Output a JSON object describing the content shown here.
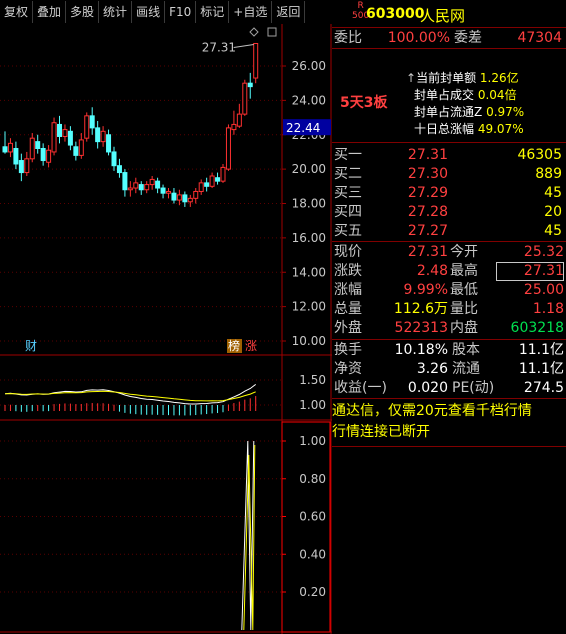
{
  "toolbar": {
    "buttons": [
      "复权",
      "叠加",
      "多股",
      "统计",
      "画线",
      "F10",
      "标记",
      "+自选",
      "返回"
    ]
  },
  "header": {
    "badge_top": "R",
    "badge_bottom": "500",
    "code": "603000",
    "name": "人民网"
  },
  "weibi": {
    "label": "委比",
    "value": "100.00%",
    "label2": "委差",
    "value2": "47304"
  },
  "board": {
    "streak": "5天3板",
    "items": [
      {
        "label": "当前封单额",
        "value": "1.26亿",
        "arrow": "↑"
      },
      {
        "label": "封单占成交",
        "value": "0.04倍"
      },
      {
        "label": "封单占流通Z",
        "value": "0.97%"
      },
      {
        "label": "十日总涨幅",
        "value": "49.07%"
      }
    ]
  },
  "order_book": [
    {
      "label": "买一",
      "price": "27.31",
      "volume": "46305"
    },
    {
      "label": "买二",
      "price": "27.30",
      "volume": "889"
    },
    {
      "label": "买三",
      "price": "27.29",
      "volume": "45"
    },
    {
      "label": "买四",
      "price": "27.28",
      "volume": "20"
    },
    {
      "label": "买五",
      "price": "27.27",
      "volume": "45"
    }
  ],
  "quote": [
    {
      "l1": "现价",
      "v1": "27.31",
      "c1": "red",
      "l2": "今开",
      "v2": "25.32",
      "c2": "red"
    },
    {
      "l1": "涨跌",
      "v1": "2.48",
      "c1": "red",
      "l2": "最高",
      "v2": "27.31",
      "c2": "red"
    },
    {
      "l1": "涨幅",
      "v1": "9.99%",
      "c1": "red",
      "l2": "最低",
      "v2": "25.00",
      "c2": "red"
    },
    {
      "l1": "总量",
      "v1": "112.6万",
      "c1": "yel",
      "l2": "量比",
      "v2": "1.18",
      "c2": "red"
    },
    {
      "l1": "外盘",
      "v1": "522313",
      "c1": "red",
      "l2": "内盘",
      "v2": "603218",
      "c2": "grn"
    }
  ],
  "fundamentals": [
    {
      "l1": "换手",
      "v1": "10.18%",
      "l2": "股本",
      "v2": "11.1亿"
    },
    {
      "l1": "净资",
      "v1": "3.26",
      "l2": "流通",
      "v2": "11.1亿"
    },
    {
      "l1": "收益(一)",
      "v1": "0.020",
      "l2": "PE(动)",
      "v2": "274.5"
    }
  ],
  "notices": [
    "通达信，仅需20元查看千档行情",
    "行情连接已断开"
  ],
  "chart": {
    "price_axis": [
      "26.00",
      "24.00",
      "22.00",
      "20.00",
      "18.00",
      "16.00",
      "14.00",
      "12.00",
      "10.00"
    ],
    "current_price_tag": "22.44",
    "high_label": "27.31",
    "tag_cai": "财",
    "tag_bang": "榜",
    "tag_zhang": "涨",
    "indicator_axis": [
      "1.50",
      "1.00"
    ],
    "osc_axis": [
      "1.00",
      "0.80",
      "0.60",
      "0.40",
      "0.20"
    ]
  },
  "chart_data": {
    "type": "candlestick",
    "ylim": [
      9.5,
      28.5
    ],
    "candles": [
      [
        21.3,
        21.0,
        22.2,
        20.9
      ],
      [
        21.0,
        21.5,
        21.8,
        20.7
      ],
      [
        21.2,
        20.3,
        21.6,
        20.0
      ],
      [
        20.5,
        19.8,
        20.9,
        19.3
      ],
      [
        19.8,
        20.6,
        21.0,
        19.6
      ],
      [
        20.6,
        21.8,
        22.1,
        20.4
      ],
      [
        21.6,
        21.2,
        22.0,
        20.9
      ],
      [
        21.2,
        20.5,
        21.5,
        20.2
      ],
      [
        20.4,
        21.1,
        21.4,
        20.1
      ],
      [
        21.0,
        22.7,
        23.0,
        20.8
      ],
      [
        22.6,
        21.9,
        23.1,
        21.5
      ],
      [
        21.9,
        22.3,
        22.6,
        21.6
      ],
      [
        22.2,
        21.4,
        22.5,
        21.1
      ],
      [
        21.3,
        20.8,
        21.6,
        20.5
      ],
      [
        20.8,
        21.7,
        22.1,
        20.6
      ],
      [
        21.8,
        23.1,
        23.3,
        21.6
      ],
      [
        23.1,
        22.4,
        23.6,
        22.0
      ],
      [
        22.4,
        21.6,
        22.8,
        21.2
      ],
      [
        21.6,
        22.2,
        22.5,
        21.3
      ],
      [
        22.0,
        21.0,
        22.3,
        20.8
      ],
      [
        21.0,
        20.2,
        21.3,
        19.9
      ],
      [
        20.2,
        19.8,
        20.6,
        19.5
      ],
      [
        19.8,
        18.8,
        20.0,
        18.4
      ],
      [
        18.8,
        18.9,
        19.3,
        18.4
      ],
      [
        18.9,
        19.2,
        19.5,
        18.6
      ],
      [
        19.1,
        18.8,
        19.3,
        18.5
      ],
      [
        18.8,
        19.1,
        19.3,
        18.6
      ],
      [
        19.1,
        19.4,
        19.6,
        18.8
      ],
      [
        19.3,
        18.9,
        19.5,
        18.6
      ],
      [
        18.9,
        18.6,
        19.1,
        18.3
      ],
      [
        18.6,
        18.7,
        18.9,
        18.3
      ],
      [
        18.6,
        18.2,
        18.9,
        18.0
      ],
      [
        18.2,
        18.5,
        18.8,
        17.9
      ],
      [
        18.5,
        18.1,
        18.7,
        17.8
      ],
      [
        18.1,
        18.3,
        18.5,
        17.8
      ],
      [
        18.3,
        18.7,
        18.9,
        18.0
      ],
      [
        18.7,
        19.2,
        19.4,
        18.5
      ],
      [
        19.2,
        19.0,
        19.5,
        18.7
      ],
      [
        19.0,
        19.6,
        19.8,
        18.9
      ],
      [
        19.5,
        19.3,
        19.8,
        19.1
      ],
      [
        19.3,
        20.1,
        20.3,
        19.2
      ],
      [
        20.0,
        22.4,
        22.6,
        19.9
      ],
      [
        22.3,
        22.6,
        23.4,
        22.0
      ],
      [
        22.5,
        23.2,
        23.8,
        22.4
      ],
      [
        23.2,
        25.0,
        25.2,
        23.1
      ],
      [
        25.0,
        24.8,
        25.6,
        24.1
      ],
      [
        25.3,
        27.31,
        27.31,
        25.0
      ]
    ]
  }
}
